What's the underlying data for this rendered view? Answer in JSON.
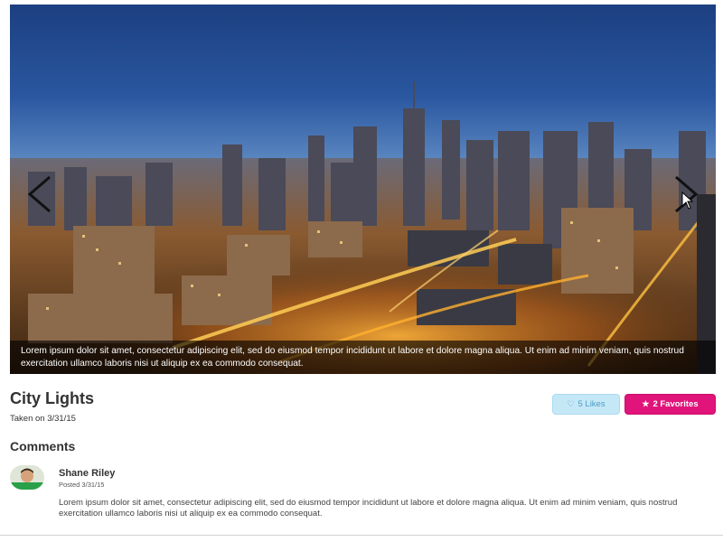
{
  "photo": {
    "caption": "Lorem ipsum dolor sit amet, consectetur adipiscing elit, sed do eiusmod tempor incididunt ut labore et dolore magna aliqua. Ut enim ad minim veniam, quis nostrud exercitation ullamco laboris nisi ut aliquip ex ea commodo consequat."
  },
  "details": {
    "title": "City Lights",
    "taken": "Taken on 3/31/15"
  },
  "actions": {
    "likes_label": "5 Likes",
    "likes_icon": "heart-outline-icon",
    "favorites_label": "2 Favorites",
    "favorites_icon": "star-icon",
    "likes_color": "#c5e8f7",
    "favorites_color": "#e0147a"
  },
  "comments": {
    "heading": "Comments",
    "items": [
      {
        "author": "Shane Riley",
        "date": "Posted 3/31/15",
        "body": "Lorem ipsum dolor sit amet, consectetur adipiscing elit, sed do eiusmod tempor incididunt ut labore et dolore magna aliqua. Ut enim ad minim veniam, quis nostrud exercitation ullamco laboris nisi ut aliquip ex ea commodo consequat."
      }
    ]
  }
}
